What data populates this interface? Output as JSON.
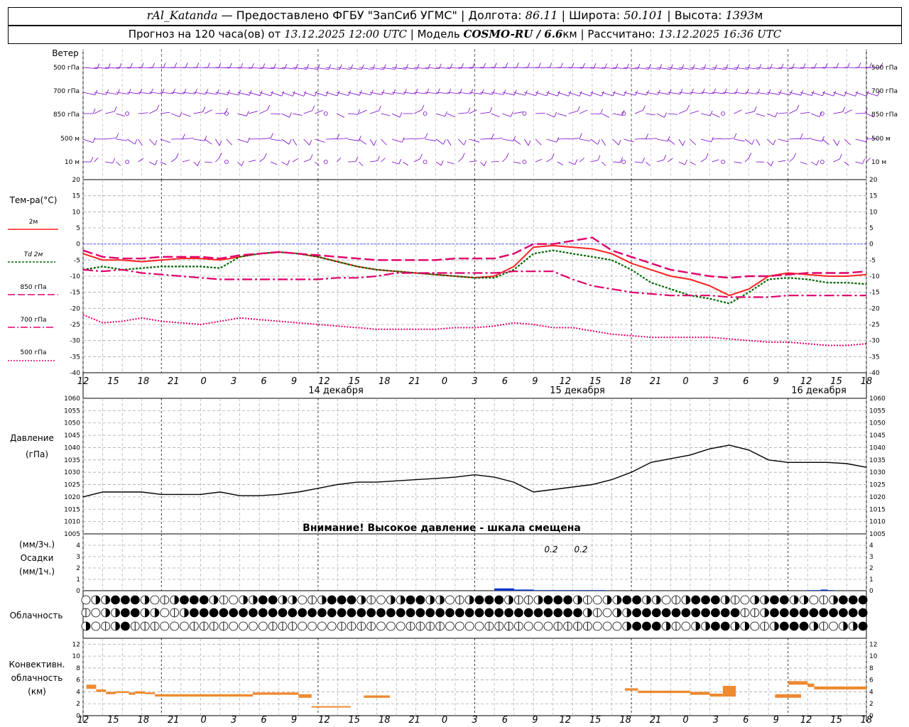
{
  "header": {
    "station": "rAl_Katanda",
    "provider": "Предоставлено ФГБУ \"ЗапСиб УГМС\"",
    "lon_label": "Долгота:",
    "lon": "86.11",
    "lat_label": "Широта:",
    "lat": "50.101",
    "alt_label": "Высота:",
    "alt": "1393",
    "alt_unit": "м",
    "forecast_label": "Прогноз на 120 часа(ов) от",
    "forecast_time": "13.12.2025 12:00 UTC",
    "model_label": "Модель",
    "model": "COSMO-RU / 6.6",
    "model_unit": "км",
    "calc_label": "Рассчитано:",
    "calc_time": "13.12.2025 16:36 UTC"
  },
  "panels": {
    "wind": {
      "title": "Ветер",
      "levels": [
        "500 гПа",
        "700 гПа",
        "850 гПа",
        "500 м",
        "10 м"
      ]
    },
    "temp": {
      "title": "Тем-ра(°C)",
      "legend": [
        "2м",
        "Td 2м",
        "850 гПа",
        "700 гПа",
        "500 гПа"
      ]
    },
    "pressure": {
      "title": "Давление",
      "unit": "(гПа)",
      "warning": "Внимание! Высокое давление - шкала смещена"
    },
    "precip": {
      "unit3": "(мм/3ч.)",
      "title": "Осадки",
      "unit1": "(мм/1ч.)",
      "labels": [
        "0.2",
        "0.2"
      ]
    },
    "cloud": {
      "title": "Облачность"
    },
    "conv": {
      "title1": "Конвективн.",
      "title2": "облачность",
      "unit": "(км)"
    }
  },
  "x_axis": {
    "hour_labels": [
      "12",
      "15",
      "18",
      "21",
      "0",
      "3",
      "6",
      "9",
      "12",
      "15",
      "18",
      "21",
      "0",
      "3",
      "6",
      "9",
      "12",
      "15",
      "18",
      "21",
      "0",
      "3",
      "6",
      "9",
      "12",
      "15",
      "18"
    ],
    "day_labels": [
      "14 декабря",
      "15 декабря",
      "16 декабря"
    ]
  },
  "colors": {
    "wind": "#7a00cc",
    "t2m": "#ff2020",
    "td2m": "#006600",
    "t850": "#e0006a",
    "t700": "#e0006a",
    "t500": "#e0006a",
    "pressure": "#000000",
    "precip": "#0033cc",
    "conv": "#ee8a30",
    "zero": "#4444ff"
  },
  "chart_data": [
    {
      "type": "line",
      "title": "Тем-ра(°C)",
      "ylim": [
        -40,
        20
      ],
      "x_hours": [
        0,
        3,
        6,
        9,
        12,
        15,
        18,
        21,
        24,
        27,
        30,
        33,
        36,
        39,
        42,
        45,
        48,
        51,
        54,
        57,
        60,
        63,
        66,
        69,
        72,
        75,
        78,
        81,
        84,
        87,
        90,
        93,
        96,
        99,
        102,
        105,
        108,
        111,
        114,
        117,
        120
      ],
      "series": [
        {
          "name": "2м",
          "values": [
            -3,
            -5,
            -5,
            -5.5,
            -5,
            -4.5,
            -4.5,
            -5,
            -4,
            -3,
            -2.5,
            -3,
            -4,
            -5.5,
            -7,
            -8,
            -8.5,
            -9,
            -9.5,
            -10,
            -10.5,
            -10,
            -7,
            -1,
            -0.5,
            -1,
            -1.5,
            -3,
            -6,
            -8,
            -10,
            -11,
            -13,
            -16,
            -14,
            -10,
            -9,
            -9.5,
            -10,
            -10,
            -9.5
          ]
        },
        {
          "name": "Td 2м",
          "values": [
            -8,
            -7,
            -8,
            -7.5,
            -7,
            -7,
            -7,
            -7.5,
            -4,
            -3,
            -2.5,
            -3,
            -4,
            -5.5,
            -7,
            -8,
            -8.5,
            -9,
            -9.5,
            -10,
            -10.5,
            -10.5,
            -8,
            -3,
            -2,
            -3,
            -4,
            -5,
            -8,
            -12,
            -14,
            -16,
            -17,
            -18.5,
            -15,
            -11,
            -10.5,
            -11,
            -12,
            -12,
            -12.5
          ]
        },
        {
          "name": "850 гПа",
          "values": [
            -2,
            -4,
            -4.5,
            -4.5,
            -4,
            -4,
            -4,
            -4.5,
            -3.5,
            -3,
            -2.5,
            -3,
            -3.5,
            -4,
            -4.5,
            -5,
            -5,
            -5,
            -5,
            -4.5,
            -4.5,
            -4.5,
            -3,
            0,
            0,
            1,
            2,
            -2,
            -4,
            -6,
            -8,
            -9,
            -10,
            -10.5,
            -10,
            -10,
            -9.5,
            -9,
            -9,
            -9,
            -8.5
          ]
        },
        {
          "name": "700 гПа",
          "values": [
            -8,
            -8.5,
            -8,
            -9,
            -9.5,
            -10,
            -10.5,
            -11,
            -11,
            -11,
            -11,
            -11,
            -11,
            -10.5,
            -10.5,
            -10,
            -9,
            -9,
            -9,
            -9,
            -9,
            -9,
            -8.5,
            -8.5,
            -8.5,
            -11,
            -13,
            -14,
            -15,
            -15.5,
            -16,
            -16,
            -16,
            -16.5,
            -16.5,
            -16.5,
            -16,
            -16,
            -16,
            -16,
            -16
          ]
        },
        {
          "name": "500 гПа",
          "values": [
            -22,
            -24.5,
            -24,
            -23,
            -24,
            -24.5,
            -25,
            -24,
            -23,
            -23.5,
            -24,
            -24.5,
            -25,
            -25.5,
            -26,
            -26.5,
            -26.5,
            -26.5,
            -26.5,
            -26,
            -26,
            -25.5,
            -24.5,
            -25,
            -26,
            -26,
            -27,
            -28,
            -28.5,
            -29,
            -29,
            -29,
            -29,
            -29.5,
            -30,
            -30.5,
            -30.5,
            -31,
            -31.5,
            -31.5,
            -31
          ]
        }
      ]
    },
    {
      "type": "line",
      "title": "Давление",
      "ylabel": "(гПа)",
      "ylim": [
        1005,
        1060
      ],
      "x_hours": [
        0,
        3,
        6,
        9,
        12,
        15,
        18,
        21,
        24,
        27,
        30,
        33,
        36,
        39,
        42,
        45,
        48,
        51,
        54,
        57,
        60,
        63,
        66,
        69,
        72,
        75,
        78,
        81,
        84,
        87,
        90,
        93,
        96,
        99,
        102,
        105,
        108,
        111,
        114,
        117,
        120
      ],
      "series": [
        {
          "name": "",
          "values": [
            1020,
            1022,
            1022,
            1022,
            1021,
            1021,
            1021,
            1022,
            1020.5,
            1020.5,
            1021,
            1022,
            1023.5,
            1025,
            1026,
            1026,
            1026.5,
            1027,
            1027.5,
            1028,
            1029,
            1028,
            1026,
            1022,
            1023,
            1024,
            1025,
            1027,
            1030,
            1034,
            1035.5,
            1037,
            1039.5,
            1041,
            1039,
            1035,
            1034,
            1034,
            1034,
            1033.5,
            1032
          ]
        }
      ]
    },
    {
      "type": "bar",
      "title": "Осадки",
      "ylabel": "(мм/1ч.)",
      "ylim": [
        0,
        5
      ],
      "x_hours": [
        57,
        58,
        59,
        60,
        61,
        62,
        63,
        64,
        65,
        66,
        67,
        68,
        69,
        70,
        71,
        72,
        73,
        74,
        75,
        76,
        77,
        78,
        79,
        80,
        81,
        82,
        83,
        84,
        85,
        86,
        87,
        88,
        89,
        90,
        91,
        92,
        93,
        94,
        95,
        96,
        97,
        98,
        99,
        100,
        101,
        102,
        103,
        104,
        105,
        106,
        107,
        108,
        109,
        110,
        111,
        112,
        113,
        114
      ],
      "values": [
        0.1,
        0.1,
        0.1,
        0.1,
        0.1,
        0.1,
        0.2,
        0.2,
        0.2,
        0.1,
        0.1,
        0.1,
        0.05,
        0.05,
        0.05,
        0.05,
        0.05,
        0.05,
        0.05,
        0.05,
        0.05,
        0.05,
        0.05,
        0.05,
        0.05,
        0.05,
        0.05,
        0.05,
        0.05,
        0.05,
        0.05,
        0.05,
        0.05,
        0.05,
        0.05,
        0.05,
        0.05,
        0.05,
        0.05,
        0.05,
        0.05,
        0.05,
        0.05,
        0.05,
        0.05,
        0.05,
        0.05,
        0.05,
        0.05,
        0.05,
        0.05,
        0.05,
        0.05,
        0.05,
        0.05,
        0.05,
        0.1,
        0.05
      ]
    },
    {
      "type": "bar",
      "title": "Конвективн. облачность",
      "ylabel": "(км)",
      "ylim": [
        0,
        13
      ],
      "segments": [
        {
          "x0": 0.5,
          "x1": 2,
          "lo": 4.5,
          "hi": 5.2
        },
        {
          "x0": 2,
          "x1": 3.5,
          "lo": 4,
          "hi": 4.4
        },
        {
          "x0": 3.5,
          "x1": 5,
          "lo": 3.6,
          "hi": 4
        },
        {
          "x0": 5,
          "x1": 7,
          "lo": 3.8,
          "hi": 4.1
        },
        {
          "x0": 7,
          "x1": 8,
          "lo": 3.5,
          "hi": 3.9
        },
        {
          "x0": 8,
          "x1": 9.5,
          "lo": 3.7,
          "hi": 4.1
        },
        {
          "x0": 9.5,
          "x1": 11,
          "lo": 3.6,
          "hi": 3.9
        },
        {
          "x0": 11,
          "x1": 26,
          "lo": 3.2,
          "hi": 3.6
        },
        {
          "x0": 26,
          "x1": 33,
          "lo": 3.5,
          "hi": 3.9
        },
        {
          "x0": 33,
          "x1": 35,
          "lo": 3,
          "hi": 3.6
        },
        {
          "x0": 35,
          "x1": 41,
          "lo": 1.4,
          "hi": 1.6
        },
        {
          "x0": 43,
          "x1": 47,
          "lo": 3,
          "hi": 3.4
        },
        {
          "x0": 83,
          "x1": 85,
          "lo": 4.2,
          "hi": 4.6
        },
        {
          "x0": 85,
          "x1": 93,
          "lo": 3.8,
          "hi": 4.2
        },
        {
          "x0": 93,
          "x1": 96,
          "lo": 3.5,
          "hi": 4
        },
        {
          "x0": 96,
          "x1": 98,
          "lo": 3.2,
          "hi": 3.7
        },
        {
          "x0": 98,
          "x1": 100,
          "lo": 3.2,
          "hi": 5
        },
        {
          "x0": 106,
          "x1": 110,
          "lo": 3,
          "hi": 3.6
        },
        {
          "x0": 108,
          "x1": 111,
          "lo": 5.2,
          "hi": 5.8
        },
        {
          "x0": 111,
          "x1": 112,
          "lo": 4.8,
          "hi": 5.4
        },
        {
          "x0": 112,
          "x1": 117,
          "lo": 4.4,
          "hi": 4.9
        },
        {
          "x0": 117,
          "x1": 120,
          "lo": 4.4,
          "hi": 4.9
        }
      ]
    }
  ]
}
